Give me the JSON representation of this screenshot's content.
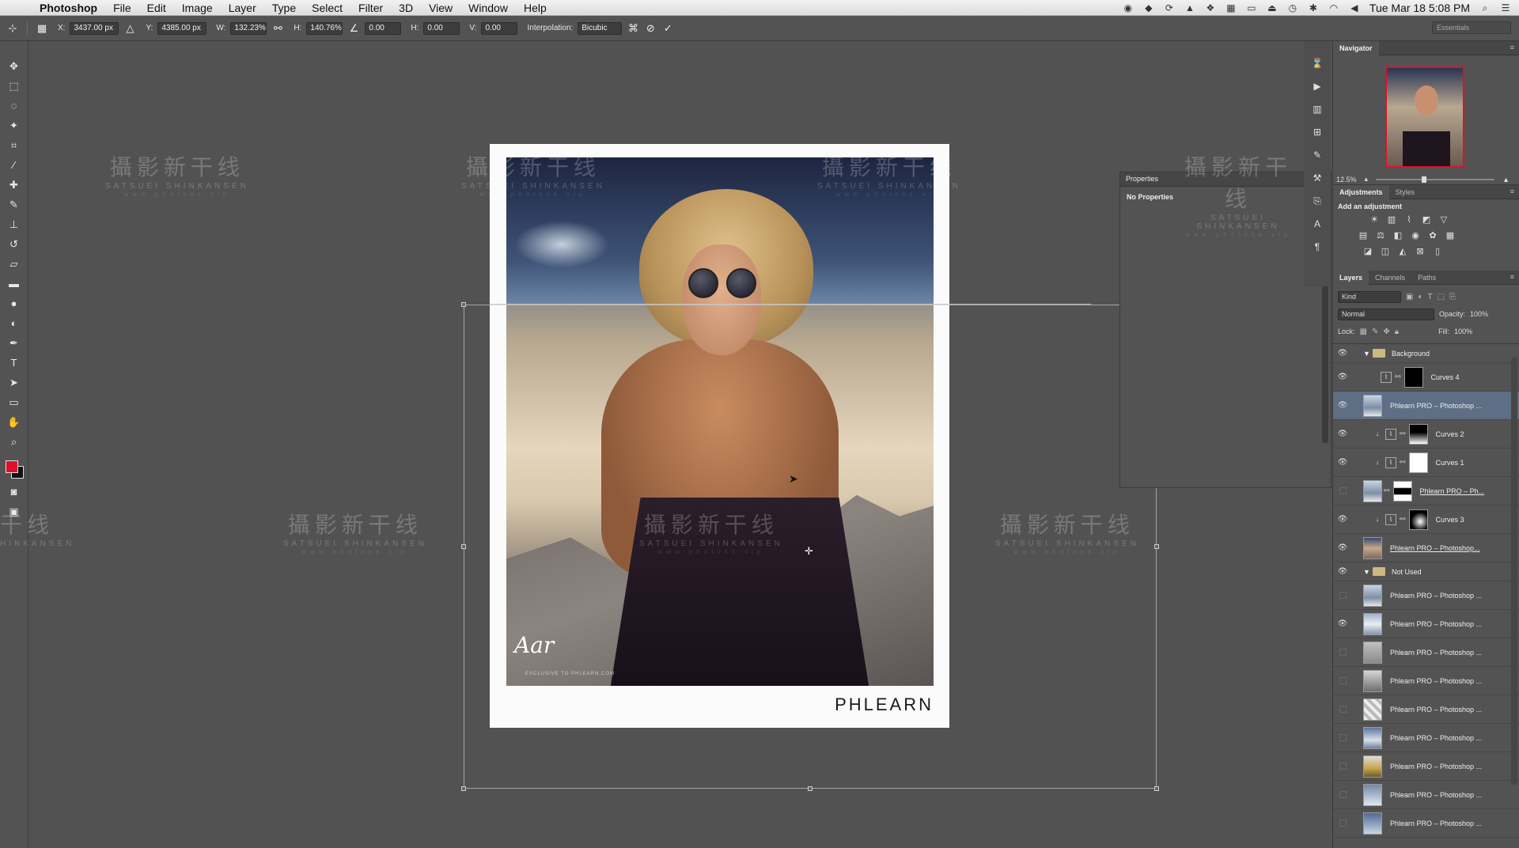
{
  "menubar": {
    "app_name": "Photoshop",
    "items": [
      "File",
      "Edit",
      "Image",
      "Layer",
      "Type",
      "Select",
      "Filter",
      "3D",
      "View",
      "Window",
      "Help"
    ],
    "clock": "Tue Mar 18  5:08 PM"
  },
  "options": {
    "x_label": "X:",
    "x_value": "3437.00 px",
    "y_label": "Y:",
    "y_value": "4385.00 px",
    "w_label": "W:",
    "w_value": "132.23%",
    "h_label": "H:",
    "h_value": "140.76%",
    "angle_value": "0.00",
    "hskew_label": "H:",
    "hskew_value": "0.00",
    "vskew_label": "V:",
    "vskew_value": "0.00",
    "interpolation_label": "Interpolation:",
    "interpolation_value": "Bicubic",
    "workspace": "Essentials"
  },
  "watermark": {
    "main": "攝影新干线",
    "sub": "SATSUEI SHINKANSEN",
    "url": "www.photoss.vip",
    "partial_main": "干线",
    "partial_sub": "HINKANSEN"
  },
  "document": {
    "brand": "PHLEARN",
    "signature": "Aar",
    "signature_caption": "EXCLUSIVE TO PHLEARN.COM"
  },
  "properties": {
    "title": "Properties",
    "body": "No Properties"
  },
  "navigator": {
    "title": "Navigator",
    "zoom": "12.5%"
  },
  "adjustments": {
    "tabs": [
      "Adjustments",
      "Styles"
    ],
    "title": "Add an adjustment"
  },
  "layers": {
    "tabs": [
      "Layers",
      "Channels",
      "Paths"
    ],
    "kind": "Kind",
    "blend_mode": "Normal",
    "opacity_label": "Opacity:",
    "opacity_value": "100%",
    "lock_label": "Lock:",
    "fill_label": "Fill:",
    "fill_value": "100%",
    "items": [
      {
        "name": "Background",
        "type": "group"
      },
      {
        "name": "Curves 4",
        "type": "adjustment"
      },
      {
        "name": "Phlearn PRO – Photoshop ...",
        "type": "image"
      },
      {
        "name": "Curves 2",
        "type": "adjustment"
      },
      {
        "name": "Curves 1",
        "type": "adjustment"
      },
      {
        "name": "Phlearn PRO – Ph...",
        "type": "image"
      },
      {
        "name": "Curves 3",
        "type": "adjustment"
      },
      {
        "name": "Phlearn PRO – Photoshop...",
        "type": "image"
      },
      {
        "name": "Not Used",
        "type": "group"
      },
      {
        "name": "Phlearn PRO – Photoshop ...",
        "type": "image"
      },
      {
        "name": "Phlearn PRO – Photoshop ...",
        "type": "image"
      },
      {
        "name": "Phlearn PRO – Photoshop ...",
        "type": "image"
      },
      {
        "name": "Phlearn PRO – Photoshop ...",
        "type": "image"
      },
      {
        "name": "Phlearn PRO – Photoshop ...",
        "type": "image"
      },
      {
        "name": "Phlearn PRO – Photoshop ...",
        "type": "image"
      },
      {
        "name": "Phlearn PRO – Photoshop ...",
        "type": "image"
      },
      {
        "name": "Phlearn PRO – Photoshop ...",
        "type": "image"
      },
      {
        "name": "Phlearn PRO – Photoshop ...",
        "type": "image"
      }
    ]
  },
  "colors": {
    "foreground": "#e0102a",
    "background": "#111111",
    "selected_layer": "#5e6e84"
  }
}
